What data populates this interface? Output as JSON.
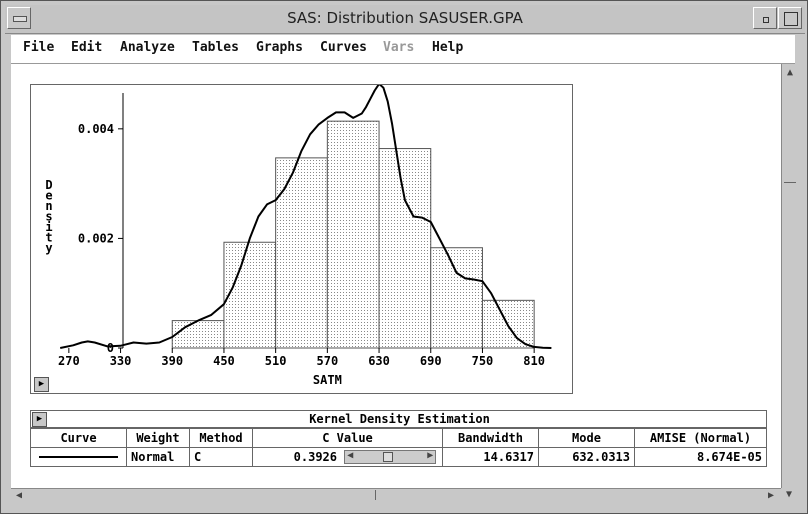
{
  "window": {
    "title": "SAS: Distribution SASUSER.GPA"
  },
  "menu": [
    {
      "label": "File",
      "enabled": true
    },
    {
      "label": "Edit",
      "enabled": true
    },
    {
      "label": "Analyze",
      "enabled": true
    },
    {
      "label": "Tables",
      "enabled": true
    },
    {
      "label": "Graphs",
      "enabled": true
    },
    {
      "label": "Curves",
      "enabled": true
    },
    {
      "label": "Vars",
      "enabled": false
    },
    {
      "label": "Help",
      "enabled": true
    }
  ],
  "chart_data": {
    "type": "bar",
    "xlabel": "SATM",
    "ylabel": "Density",
    "x_ticks": [
      270,
      330,
      390,
      450,
      510,
      570,
      630,
      690,
      750,
      810
    ],
    "y_ticks": [
      "0",
      "0.002",
      "0.004"
    ],
    "xlim": [
      240,
      840
    ],
    "ylim": [
      0,
      0.0048
    ],
    "bins": [
      {
        "from": 390,
        "to": 450,
        "density": 0.0005
      },
      {
        "from": 450,
        "to": 510,
        "density": 0.00193
      },
      {
        "from": 510,
        "to": 570,
        "density": 0.00347
      },
      {
        "from": 570,
        "to": 630,
        "density": 0.00414
      },
      {
        "from": 630,
        "to": 690,
        "density": 0.00364
      },
      {
        "from": 690,
        "to": 750,
        "density": 0.00183
      },
      {
        "from": 750,
        "to": 810,
        "density": 0.00087
      }
    ],
    "curve": {
      "x": [
        260,
        275,
        285,
        292,
        300,
        315,
        330,
        345,
        360,
        375,
        390,
        405,
        420,
        435,
        450,
        460,
        470,
        480,
        490,
        500,
        510,
        520,
        530,
        540,
        550,
        560,
        570,
        580,
        590,
        600,
        610,
        615,
        620,
        625,
        630,
        635,
        640,
        645,
        650,
        655,
        660,
        670,
        680,
        690,
        700,
        710,
        720,
        730,
        740,
        750,
        760,
        770,
        780,
        790,
        800,
        810,
        820,
        830
      ],
      "y": [
        0,
        5e-05,
        0.0001,
        0.00012,
        0.0001,
        3e-05,
        4e-05,
        0.0001,
        8e-05,
        0.0001,
        0.0002,
        0.00038,
        0.0005,
        0.0006,
        0.0008,
        0.0011,
        0.0015,
        0.002,
        0.0024,
        0.00262,
        0.0027,
        0.0029,
        0.0032,
        0.0036,
        0.0039,
        0.00408,
        0.0042,
        0.0043,
        0.0043,
        0.0042,
        0.00428,
        0.0044,
        0.00455,
        0.0047,
        0.00482,
        0.00475,
        0.0045,
        0.0041,
        0.0036,
        0.0031,
        0.0027,
        0.0024,
        0.00238,
        0.0023,
        0.002,
        0.0017,
        0.00137,
        0.00127,
        0.00125,
        0.00122,
        0.001,
        0.0007,
        0.0004,
        0.00018,
        7e-05,
        2e-05,
        5e-06,
        0
      ]
    }
  },
  "kde": {
    "title": "Kernel Density Estimation",
    "headers": {
      "curve": "Curve",
      "weight": "Weight",
      "method": "Method",
      "cvalue": "C Value",
      "bandwidth": "Bandwidth",
      "mode": "Mode",
      "amise": "AMISE (Normal)"
    },
    "row": {
      "weight": "Normal",
      "method": "C",
      "cvalue": "0.3926",
      "bandwidth": "14.6317",
      "mode": "632.0313",
      "amise": "8.674E-05"
    }
  }
}
